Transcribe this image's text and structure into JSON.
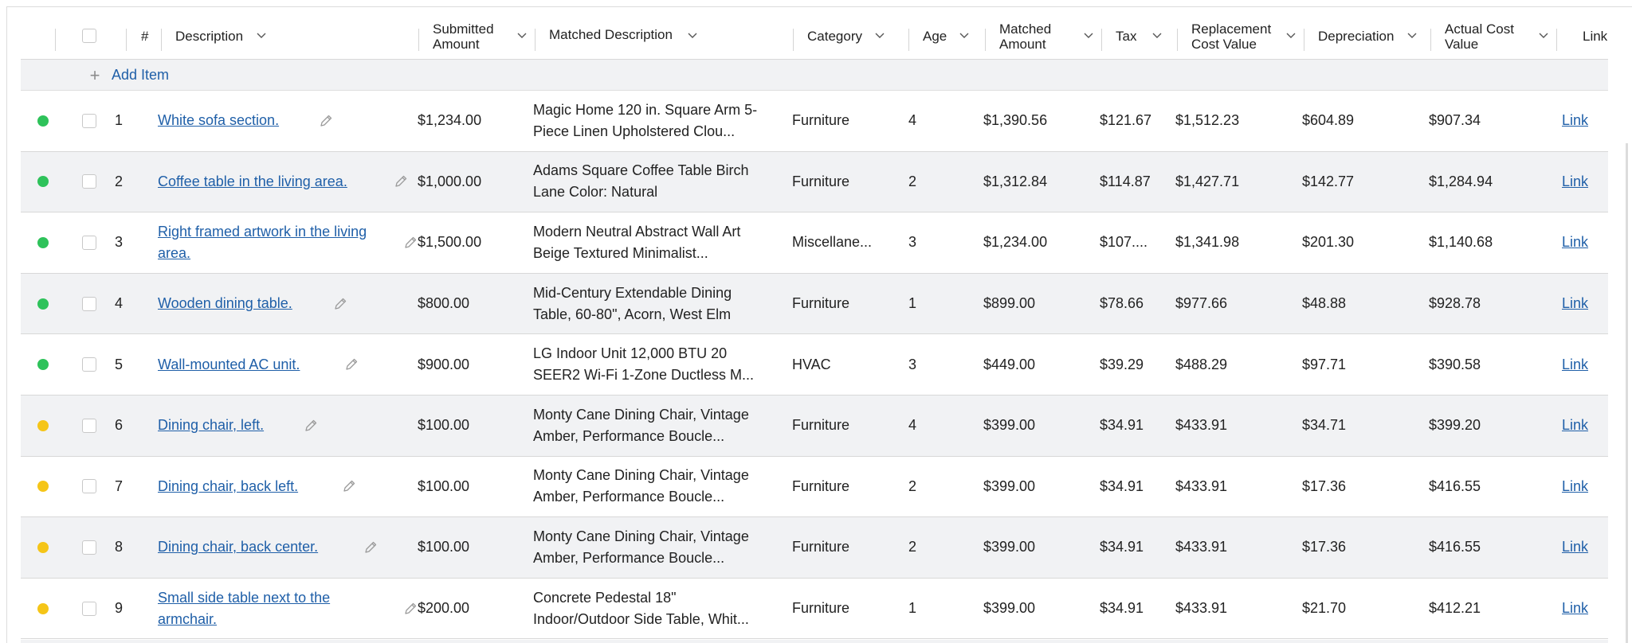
{
  "colors": {
    "green": "#2ec25a",
    "yellow": "#f5c518",
    "link": "#1f5fa8"
  },
  "header": {
    "num": "#",
    "description": "Description",
    "submitted_amount": [
      "Submitted",
      "Amount"
    ],
    "matched_description": "Matched Description",
    "category": "Category",
    "age": "Age",
    "matched_amount": [
      "Matched",
      "Amount"
    ],
    "tax": "Tax",
    "replacement_cost_value": [
      "Replacement",
      "Cost Value"
    ],
    "depreciation": "Depreciation",
    "actual_cost_value": [
      "Actual Cost",
      "Value"
    ],
    "link": "Link"
  },
  "add_item": {
    "icon": "plus-icon",
    "label": "Add Item"
  },
  "rows": [
    {
      "status": "green",
      "num": "1",
      "description": "White sofa section.",
      "submitted": "$1,234.00",
      "matched": "Magic Home 120 in. Square Arm 5-Piece Linen Upholstered Clou...",
      "category": "Furniture",
      "age": "4",
      "matched_amount": "$1,390.56",
      "tax": "$121.67",
      "rcv": "$1,512.23",
      "depreciation": "$604.89",
      "acv": "$907.34",
      "link": "Link"
    },
    {
      "status": "green",
      "num": "2",
      "description": "Coffee table in the living area.",
      "submitted": "$1,000.00",
      "matched": "Adams Square Coffee Table Birch Lane Color: Natural",
      "category": "Furniture",
      "age": "2",
      "matched_amount": "$1,312.84",
      "tax": "$114.87",
      "rcv": "$1,427.71",
      "depreciation": "$142.77",
      "acv": "$1,284.94",
      "link": "Link"
    },
    {
      "status": "green",
      "num": "3",
      "description": "Right framed artwork in the living area.",
      "submitted": "$1,500.00",
      "matched": "Modern Neutral Abstract Wall Art Beige Textured Minimalist...",
      "category": "Miscellane...",
      "age": "3",
      "matched_amount": "$1,234.00",
      "tax": "$107....",
      "rcv": "$1,341.98",
      "depreciation": "$201.30",
      "acv": "$1,140.68",
      "link": "Link"
    },
    {
      "status": "green",
      "num": "4",
      "description": "Wooden dining table.",
      "submitted": "$800.00",
      "matched": "Mid-Century Extendable Dining Table, 60-80\", Acorn, West Elm",
      "category": "Furniture",
      "age": "1",
      "matched_amount": "$899.00",
      "tax": "$78.66",
      "rcv": "$977.66",
      "depreciation": "$48.88",
      "acv": "$928.78",
      "link": "Link"
    },
    {
      "status": "green",
      "num": "5",
      "description": "Wall-mounted AC unit.",
      "submitted": "$900.00",
      "matched": "LG Indoor Unit 12,000 BTU 20 SEER2 Wi-Fi 1-Zone Ductless M...",
      "category": "HVAC",
      "age": "3",
      "matched_amount": "$449.00",
      "tax": "$39.29",
      "rcv": "$488.29",
      "depreciation": "$97.71",
      "acv": "$390.58",
      "link": "Link"
    },
    {
      "status": "yellow",
      "num": "6",
      "description": "Dining chair, left.",
      "submitted": "$100.00",
      "matched": "Monty Cane Dining Chair, Vintage Amber, Performance Boucle...",
      "category": "Furniture",
      "age": "4",
      "matched_amount": "$399.00",
      "tax": "$34.91",
      "rcv": "$433.91",
      "depreciation": "$34.71",
      "acv": "$399.20",
      "link": "Link"
    },
    {
      "status": "yellow",
      "num": "7",
      "description": "Dining chair, back left.",
      "submitted": "$100.00",
      "matched": "Monty Cane Dining Chair, Vintage Amber, Performance Boucle...",
      "category": "Furniture",
      "age": "2",
      "matched_amount": "$399.00",
      "tax": "$34.91",
      "rcv": "$433.91",
      "depreciation": "$17.36",
      "acv": "$416.55",
      "link": "Link"
    },
    {
      "status": "yellow",
      "num": "8",
      "description": "Dining chair, back center.",
      "submitted": "$100.00",
      "matched": "Monty Cane Dining Chair, Vintage Amber, Performance Boucle...",
      "category": "Furniture",
      "age": "2",
      "matched_amount": "$399.00",
      "tax": "$34.91",
      "rcv": "$433.91",
      "depreciation": "$17.36",
      "acv": "$416.55",
      "link": "Link"
    },
    {
      "status": "yellow",
      "num": "9",
      "description": "Small side table next to the armchair.",
      "submitted": "$200.00",
      "matched": "Concrete Pedestal 18\" Indoor/Outdoor Side Table, Whit...",
      "category": "Furniture",
      "age": "1",
      "matched_amount": "$399.00",
      "tax": "$34.91",
      "rcv": "$433.91",
      "depreciation": "$21.70",
      "acv": "$412.21",
      "link": "Link"
    }
  ]
}
